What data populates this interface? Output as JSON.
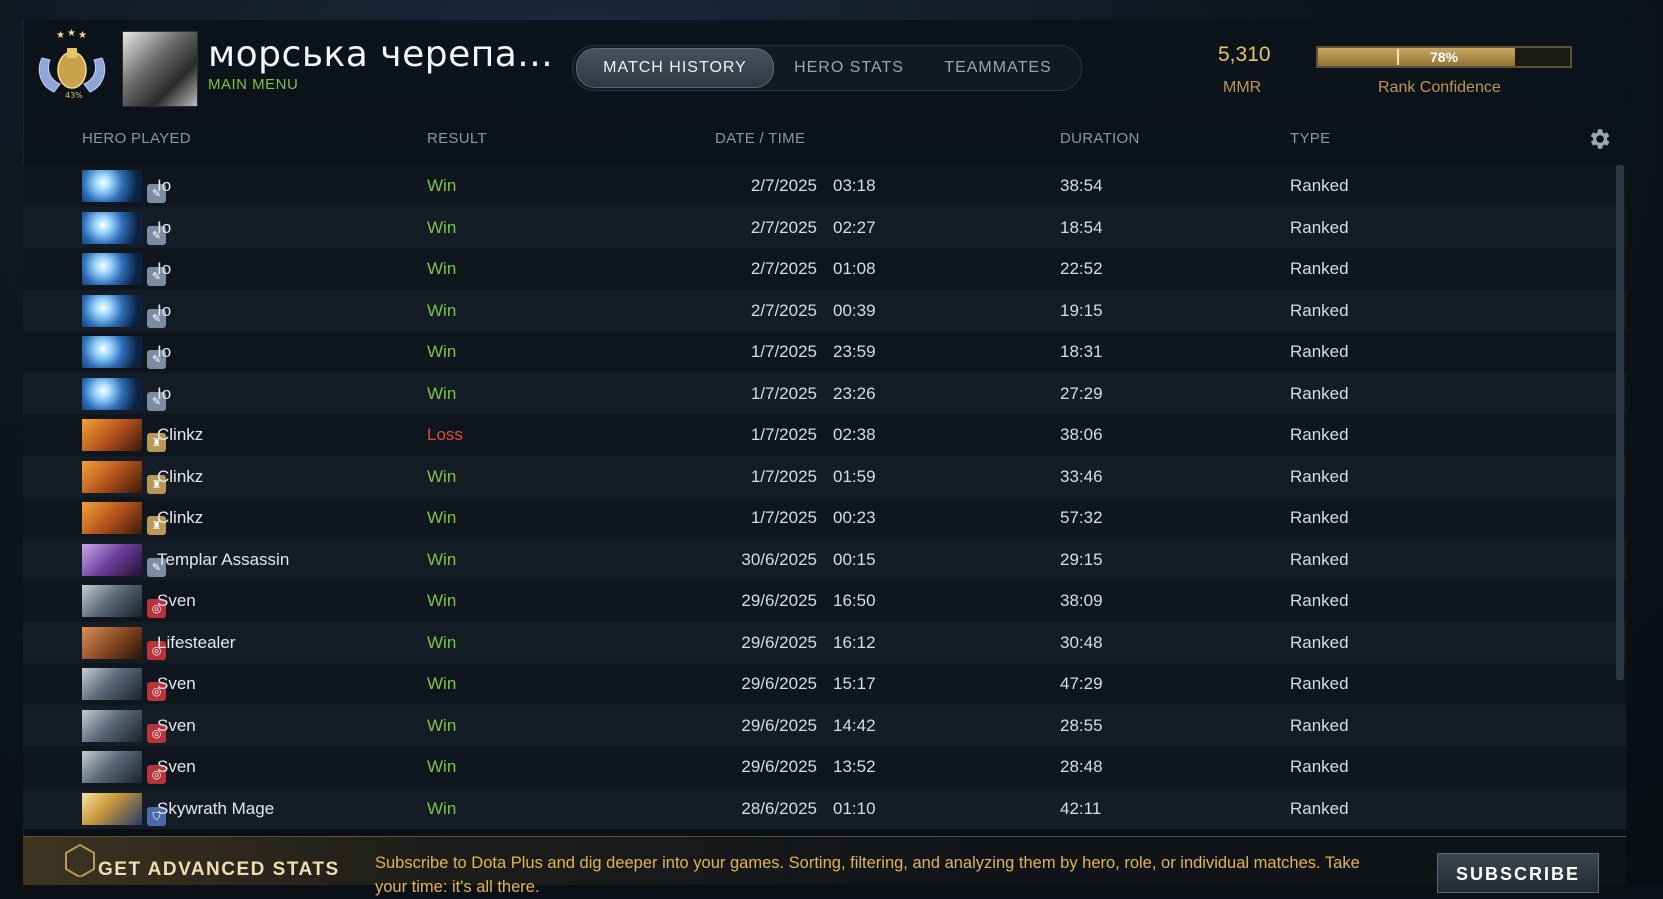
{
  "profile": {
    "name": "морська черепа...",
    "main_menu": "MAIN MENU",
    "rank_badge_text": "43%"
  },
  "tabs": [
    {
      "label": "MATCH HISTORY",
      "active": true
    },
    {
      "label": "HERO STATS",
      "active": false
    },
    {
      "label": "TEAMMATES",
      "active": false
    }
  ],
  "stats": {
    "mmr_value": "5,310",
    "mmr_label": "MMR",
    "rank_confidence_percent": 78,
    "rank_confidence_text": "78%",
    "rank_confidence_label": "Rank Confidence"
  },
  "columns": {
    "hero": "HERO PLAYED",
    "result": "RESULT",
    "datetime": "DATE / TIME",
    "duration": "DURATION",
    "type": "TYPE"
  },
  "colors": {
    "win": "#7fc346",
    "loss": "#e0483c",
    "gold": "#e6c469"
  },
  "matches": [
    {
      "hero": "Io",
      "icon": "io",
      "result": "Win",
      "date": "2/7/2025",
      "time": "03:18",
      "duration": "38:54",
      "type": "Ranked"
    },
    {
      "hero": "Io",
      "icon": "io",
      "result": "Win",
      "date": "2/7/2025",
      "time": "02:27",
      "duration": "18:54",
      "type": "Ranked"
    },
    {
      "hero": "Io",
      "icon": "io",
      "result": "Win",
      "date": "2/7/2025",
      "time": "01:08",
      "duration": "22:52",
      "type": "Ranked"
    },
    {
      "hero": "Io",
      "icon": "io",
      "result": "Win",
      "date": "2/7/2025",
      "time": "00:39",
      "duration": "19:15",
      "type": "Ranked"
    },
    {
      "hero": "Io",
      "icon": "io",
      "result": "Win",
      "date": "1/7/2025",
      "time": "23:59",
      "duration": "18:31",
      "type": "Ranked"
    },
    {
      "hero": "Io",
      "icon": "io",
      "result": "Win",
      "date": "1/7/2025",
      "time": "23:26",
      "duration": "27:29",
      "type": "Ranked"
    },
    {
      "hero": "Clinkz",
      "icon": "clinkz",
      "result": "Loss",
      "date": "1/7/2025",
      "time": "02:38",
      "duration": "38:06",
      "type": "Ranked"
    },
    {
      "hero": "Clinkz",
      "icon": "clinkz",
      "result": "Win",
      "date": "1/7/2025",
      "time": "01:59",
      "duration": "33:46",
      "type": "Ranked"
    },
    {
      "hero": "Clinkz",
      "icon": "clinkz",
      "result": "Win",
      "date": "1/7/2025",
      "time": "00:23",
      "duration": "57:32",
      "type": "Ranked"
    },
    {
      "hero": "Templar Assassin",
      "icon": "templar",
      "result": "Win",
      "date": "30/6/2025",
      "time": "00:15",
      "duration": "29:15",
      "type": "Ranked"
    },
    {
      "hero": "Sven",
      "icon": "sven",
      "result": "Win",
      "date": "29/6/2025",
      "time": "16:50",
      "duration": "38:09",
      "type": "Ranked"
    },
    {
      "hero": "Lifestealer",
      "icon": "lifestealer",
      "result": "Win",
      "date": "29/6/2025",
      "time": "16:12",
      "duration": "30:48",
      "type": "Ranked"
    },
    {
      "hero": "Sven",
      "icon": "sven",
      "result": "Win",
      "date": "29/6/2025",
      "time": "15:17",
      "duration": "47:29",
      "type": "Ranked"
    },
    {
      "hero": "Sven",
      "icon": "sven",
      "result": "Win",
      "date": "29/6/2025",
      "time": "14:42",
      "duration": "28:55",
      "type": "Ranked"
    },
    {
      "hero": "Sven",
      "icon": "sven",
      "result": "Win",
      "date": "29/6/2025",
      "time": "13:52",
      "duration": "28:48",
      "type": "Ranked"
    },
    {
      "hero": "Skywrath Mage",
      "icon": "skywrath",
      "result": "Win",
      "date": "28/6/2025",
      "time": "01:10",
      "duration": "42:11",
      "type": "Ranked"
    }
  ],
  "footer": {
    "title": "GET ADVANCED STATS",
    "text": "Subscribe to Dota Plus and dig deeper into your games. Sorting, filtering, and analyzing them by hero, role, or individual matches. Take your time: it's all there.",
    "subscribe_label": "SUBSCRIBE"
  }
}
